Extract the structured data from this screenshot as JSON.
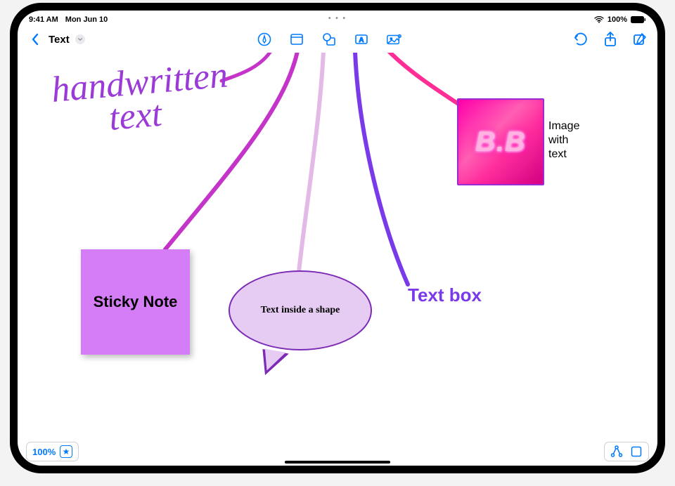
{
  "status": {
    "time": "9:41 AM",
    "date": "Mon Jun 10",
    "battery_pct": "100%"
  },
  "header": {
    "board_title": "Text"
  },
  "toolbar": {
    "center_icons": [
      "pen-tool-icon",
      "sticky-note-icon",
      "shape-icon",
      "text-box-icon",
      "media-icon"
    ],
    "right_icons": [
      "undo-icon",
      "share-icon",
      "compose-icon"
    ]
  },
  "canvas": {
    "handwritten": "handwritten\n      text",
    "sticky_label": "Sticky Note",
    "speech_label": "Text inside a shape",
    "text_box_label": "Text box",
    "image_text": "B.B",
    "image_caption": "Image\nwith\ntext",
    "colors": {
      "handwritten": "#9a3bd8",
      "line_magenta": "#c534c8",
      "line_pink_light": "#e3b9e8",
      "line_purple": "#7a3aea",
      "line_hot_pink": "#ff2d96",
      "sticky_bg": "#d57df6",
      "speech_fill": "#e6cbf2",
      "speech_stroke": "#7b2bb5",
      "text_box": "#7a3aea"
    }
  },
  "footer": {
    "zoom": "100%"
  }
}
